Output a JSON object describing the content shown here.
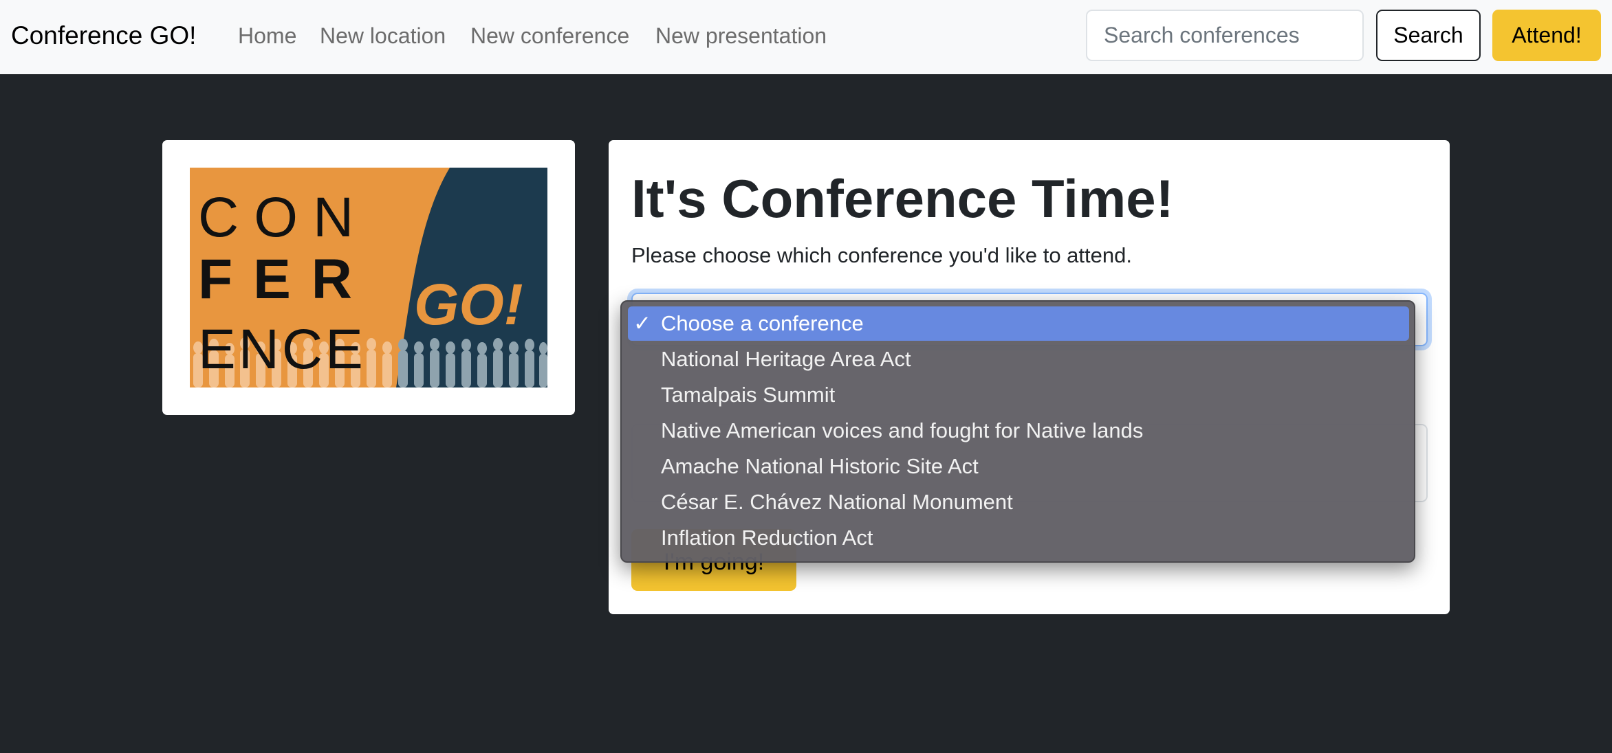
{
  "navbar": {
    "brand": "Conference GO!",
    "links": [
      "Home",
      "New location",
      "New conference",
      "New presentation"
    ],
    "search_placeholder": "Search conferences",
    "search_button": "Search",
    "attend_button": "Attend!"
  },
  "logo": {
    "line1": "CON",
    "line2": "FER",
    "line3": "ENCE",
    "tagline": "GO!",
    "colors": {
      "orange": "#E8963F",
      "navy": "#1C3A4E"
    }
  },
  "form": {
    "heading": "It's Conference Time!",
    "subtext": "Please choose which conference you'd like to attend.",
    "submit_label": "I'm going!"
  },
  "dropdown": {
    "check_mark": "✓",
    "options": [
      "Choose a conference",
      "National Heritage Area Act",
      "Tamalpais Summit",
      "Native American voices and fought for Native lands",
      "Amache National Historic Site Act",
      "César E. Chávez National Monument",
      "Inflation Reduction Act"
    ],
    "selected_index": 0
  },
  "colors": {
    "page_bg": "#212529",
    "navbar_bg": "#F8F9FA",
    "accent_yellow": "#F4C430",
    "selection_blue": "#6789E0"
  }
}
